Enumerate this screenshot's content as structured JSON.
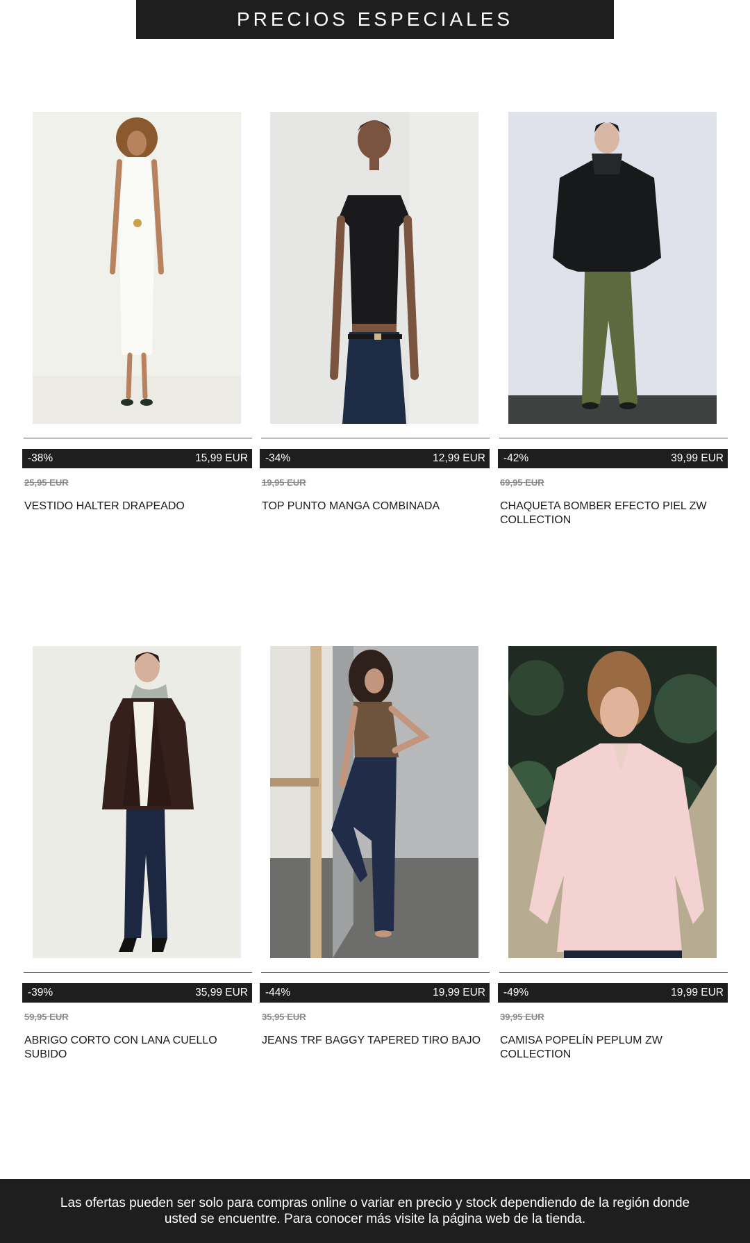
{
  "banner": {
    "title": "PRECIOS ESPECIALES"
  },
  "products": [
    {
      "discount": "-38%",
      "price": "15,99 EUR",
      "old_price": "25,95 EUR",
      "name": "VESTIDO HALTER DRAPEADO",
      "image": "woman-white-halter-dress-photo"
    },
    {
      "discount": "-34%",
      "price": "12,99 EUR",
      "old_price": "19,95 EUR",
      "name": "TOP PUNTO MANGA COMBINADA",
      "image": "woman-black-knit-top-jeans-photo"
    },
    {
      "discount": "-42%",
      "price": "39,99 EUR",
      "old_price": "69,95 EUR",
      "name": "CHAQUETA BOMBER EFECTO PIEL ZW COLLECTION",
      "image": "woman-black-leather-bomber-photo"
    },
    {
      "discount": "-39%",
      "price": "35,99 EUR",
      "old_price": "59,95 EUR",
      "name": "ABRIGO CORTO CON LANA CUELLO SUBIDO",
      "image": "woman-brown-wool-coat-photo"
    },
    {
      "discount": "-44%",
      "price": "19,99 EUR",
      "old_price": "35,95 EUR",
      "name": "JEANS TRF BAGGY TAPERED TIRO BAJO",
      "image": "woman-baggy-jeans-photo"
    },
    {
      "discount": "-49%",
      "price": "19,99 EUR",
      "old_price": "39,95 EUR",
      "name": "CAMISA POPELÍN PEPLUM ZW COLLECTION",
      "image": "woman-pink-peplum-shirt-photo"
    }
  ],
  "footer": {
    "disclaimer": "Las ofertas pueden ser solo para compras online o variar en precio y stock dependiendo de la región donde usted se encuentre. Para conocer más visite la página web de la tienda."
  },
  "colors": {
    "dark": "#1e1e1e",
    "text": "#1b1b1b",
    "muted": "#8a8a8a"
  }
}
